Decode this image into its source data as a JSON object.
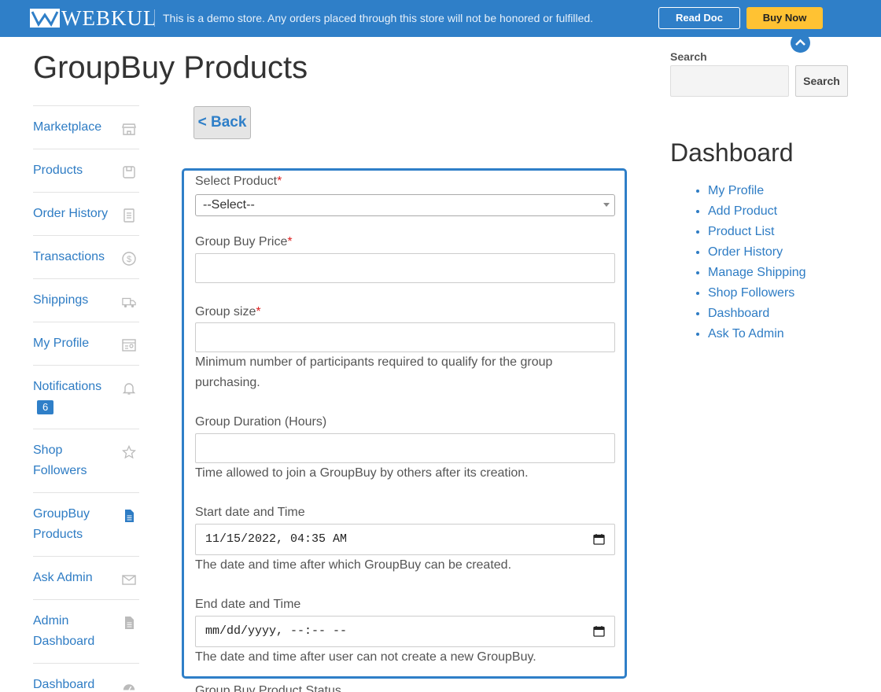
{
  "banner": {
    "logo_text": "WEBKUL",
    "notice": "This is a demo store. Any orders placed through this store will not be honored or fulfilled.",
    "read_doc": "Read Doc",
    "buy_now": "Buy Now"
  },
  "page": {
    "title": "GroupBuy Products",
    "back": "< Back"
  },
  "sidebar": {
    "items": [
      {
        "label": "Marketplace",
        "icon": "storefront-icon"
      },
      {
        "label": "Products",
        "icon": "product-box-icon"
      },
      {
        "label": "Order History",
        "icon": "document-icon"
      },
      {
        "label": "Transactions",
        "icon": "dollar-icon"
      },
      {
        "label": "Shippings",
        "icon": "truck-icon"
      },
      {
        "label": "My Profile",
        "icon": "profile-card-icon"
      },
      {
        "label": "Notifications",
        "icon": "bell-icon",
        "badge": "6"
      },
      {
        "label": "Shop Followers",
        "icon": "star-icon"
      },
      {
        "label": "GroupBuy Products",
        "icon": "file-icon",
        "active": true
      },
      {
        "label": "Ask Admin",
        "icon": "envelope-icon"
      },
      {
        "label": "Admin Dashboard",
        "icon": "file-icon"
      },
      {
        "label": "Dashboard",
        "icon": "gauge-icon"
      }
    ]
  },
  "form": {
    "select_product": {
      "label": "Select Product",
      "required": "*",
      "value": "--Select--"
    },
    "group_buy_price": {
      "label": "Group Buy Price",
      "required": "*",
      "value": ""
    },
    "group_size": {
      "label": "Group size",
      "required": "*",
      "value": "",
      "help": "Minimum number of participants required to qualify for the group purchasing."
    },
    "group_duration": {
      "label": "Group Duration (Hours)",
      "value": "",
      "help": "Time allowed to join a GroupBuy by others after its creation."
    },
    "start_datetime": {
      "label": "Start date and Time",
      "value": "11/15/2022, 04:35 AM",
      "help": "The date and time after which GroupBuy can be created."
    },
    "end_datetime": {
      "label": "End date and Time",
      "value": "mm/dd/yyyy, --:-- --",
      "help": "The date and time after user can not create a new GroupBuy."
    },
    "next_label_partial": "Group Buy Product Status"
  },
  "right": {
    "search_label": "Search",
    "search_placeholder": "",
    "search_button": "Search",
    "dashboard_title": "Dashboard",
    "dashboard_links": [
      "My Profile",
      "Add Product",
      "Product List",
      "Order History",
      "Manage Shipping",
      "Shop Followers",
      "Dashboard",
      "Ask To Admin"
    ]
  },
  "colors": {
    "accent": "#2f7fc8",
    "buy_now": "#ffc233",
    "required": "#dd2222"
  }
}
